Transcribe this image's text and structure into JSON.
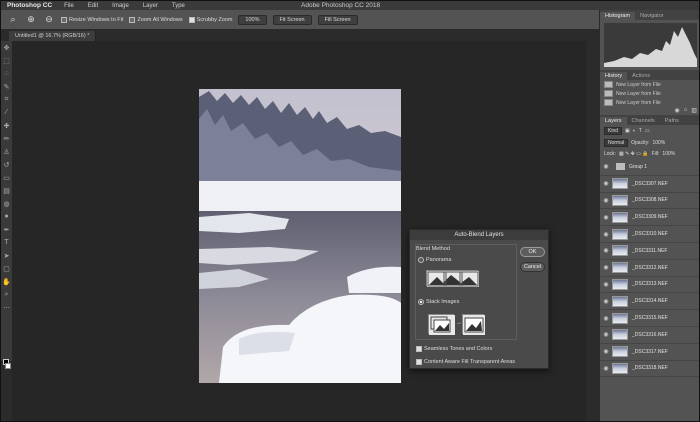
{
  "window_title": "Adobe Photoshop CC 2018",
  "menubar": {
    "app": "Photoshop CC",
    "items": [
      "File",
      "Edit",
      "Image",
      "Layer",
      "Type"
    ]
  },
  "options_bar": {
    "resize_windows_label": "Resize Windows to Fit",
    "zoom_all_label": "Zoom All Windows",
    "scrubby_zoom_label": "Scrubby Zoom",
    "zoom_value": "100%",
    "fit_screen_label": "Fit Screen",
    "fill_screen_label": "Fill Screen"
  },
  "document_tab": {
    "label": "Untitled1 @ 16.7% (RGB/16) *",
    "close": "×"
  },
  "dialog": {
    "title": "Auto-Blend Layers",
    "group_label": "Blend Method",
    "panorama_label": "Panorama",
    "stack_label": "Stack Images",
    "seamless_label": "Seamless Tones and Colors",
    "content_aware_label": "Content Aware Fill Transparent Areas",
    "ok_label": "OK",
    "cancel_label": "Cancel"
  },
  "panels": {
    "top_tabs": [
      "Histogram",
      "Navigator"
    ],
    "history_tabs": [
      "History",
      "Actions"
    ],
    "history_items": [
      "New Layer from File",
      "New Layer from File",
      "New Layer from File"
    ],
    "layer_tabs": [
      "Layers",
      "Channels",
      "Paths"
    ],
    "kind_label": "Kind",
    "blend_mode": "Normal",
    "opacity_label": "Opacity:",
    "opacity_value": "100%",
    "lock_label": "Lock:",
    "fill_label": "Fill:",
    "fill_value": "100%",
    "group_name": "Group 1",
    "layers": [
      "_DSC3307.NEF",
      "_DSC3308.NEF",
      "_DSC3309.NEF",
      "_DSC3310.NEF",
      "_DSC3311.NEF",
      "_DSC3312.NEF",
      "_DSC3313.NEF",
      "_DSC3314.NEF",
      "_DSC3315.NEF",
      "_DSC3316.NEF",
      "_DSC3317.NEF",
      "_DSC3318.NEF"
    ]
  },
  "colors": {
    "app_bg": "#2b2b2b",
    "panel_bg": "#535353",
    "dialog_bg": "#4a4a4a"
  }
}
